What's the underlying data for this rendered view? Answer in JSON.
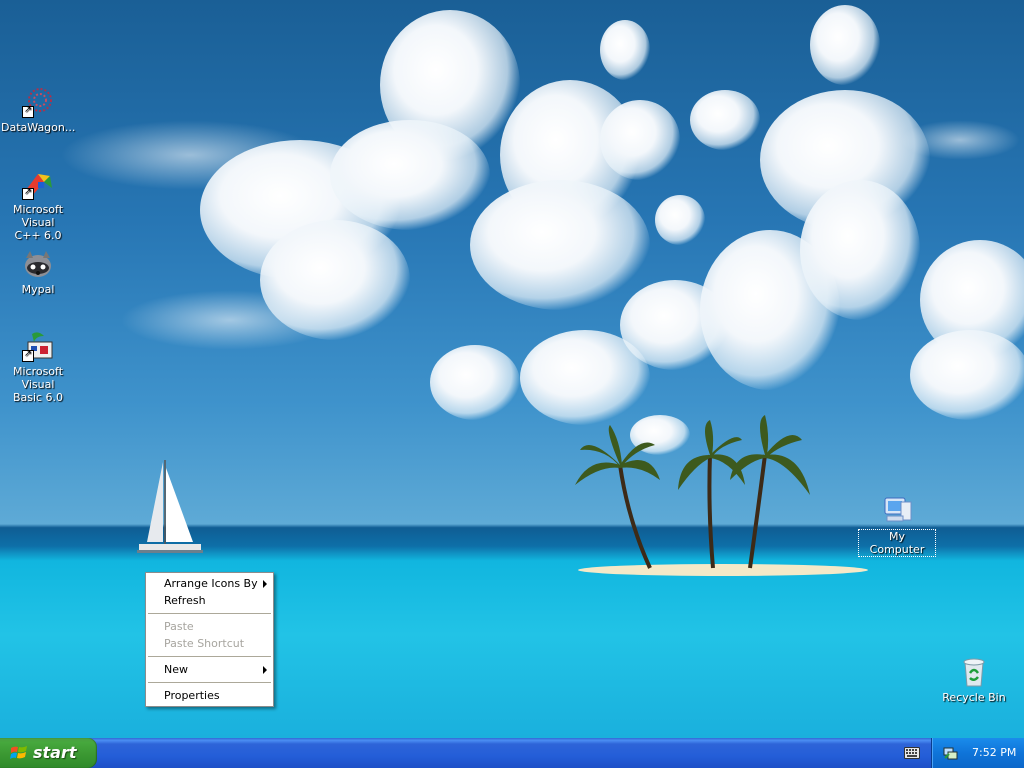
{
  "desktop": {
    "icons": [
      {
        "name": "datawagon-icon",
        "label": "DataWagon...",
        "shortcut": true
      },
      {
        "name": "visual-cpp-icon",
        "label": "Microsoft Visual\nC++ 6.0",
        "shortcut": true
      },
      {
        "name": "mypal-icon",
        "label": "Mypal",
        "shortcut": false
      },
      {
        "name": "visual-basic-icon",
        "label": "Microsoft Visual\nBasic 6.0",
        "shortcut": true
      },
      {
        "name": "my-computer-icon",
        "label": "My Computer",
        "shortcut": false
      },
      {
        "name": "recycle-bin-icon",
        "label": "Recycle Bin",
        "shortcut": false
      }
    ]
  },
  "context_menu": {
    "items": [
      {
        "label": "Arrange Icons By",
        "submenu": true,
        "enabled": true
      },
      {
        "label": "Refresh",
        "submenu": false,
        "enabled": true
      },
      {
        "separator": true
      },
      {
        "label": "Paste",
        "submenu": false,
        "enabled": false
      },
      {
        "label": "Paste Shortcut",
        "submenu": false,
        "enabled": false
      },
      {
        "separator": true
      },
      {
        "label": "New",
        "submenu": true,
        "enabled": true
      },
      {
        "separator": true
      },
      {
        "label": "Properties",
        "submenu": false,
        "enabled": true
      }
    ]
  },
  "taskbar": {
    "start_label": "start",
    "clock": "7:52 PM"
  },
  "colors": {
    "taskbar_blue": "#245ed8",
    "start_green": "#3b9832",
    "tray_blue": "#0f74d9"
  }
}
